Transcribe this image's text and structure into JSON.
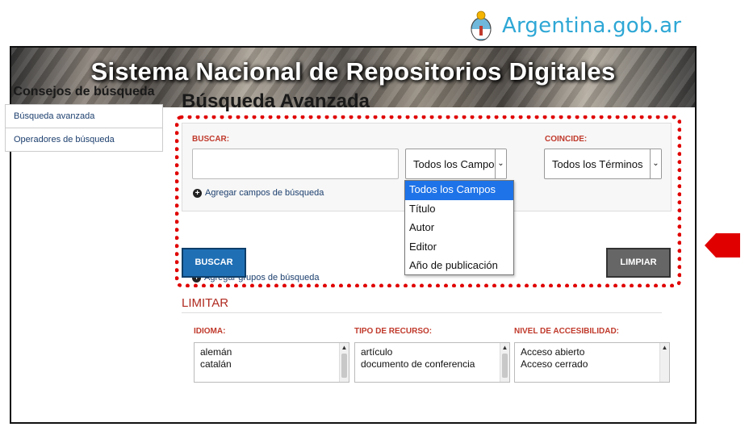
{
  "gov_header": {
    "site": "Argentina.gob.ar",
    "icon": "argentina-seal-icon"
  },
  "banner": {
    "title": "Sistema Nacional de Repositorios Digitales"
  },
  "sidebar": {
    "title": "Consejos de búsqueda",
    "items": [
      {
        "label": "Búsqueda avanzada"
      },
      {
        "label": "Operadores de búsqueda"
      }
    ]
  },
  "main": {
    "title": "Búsqueda Avanzada",
    "search": {
      "buscar_label": "BUSCAR:",
      "query_value": "",
      "field_select_value": "Todos los Campos",
      "coincide_label": "COINCIDE:",
      "match_select_value": "Todos los Términos",
      "add_fields_label": "Agregar campos de búsqueda",
      "add_groups_label": "Agregar grupos de búsqueda"
    },
    "dropdown_options": [
      {
        "label": "Todos los Campos",
        "selected": true
      },
      {
        "label": "Título",
        "selected": false
      },
      {
        "label": "Autor",
        "selected": false
      },
      {
        "label": "Editor",
        "selected": false
      },
      {
        "label": "Año de publicación",
        "selected": false
      }
    ],
    "buttons": {
      "search": "BUSCAR",
      "clear": "LIMPIAR"
    },
    "limit": {
      "title": "LIMITAR",
      "columns": [
        {
          "label": "IDIOMA:",
          "items": [
            "alemán",
            "catalán"
          ]
        },
        {
          "label": "TIPO DE RECURSO:",
          "items": [
            "artículo",
            "documento de conferencia"
          ]
        },
        {
          "label": "NIVEL DE ACCESIBILIDAD:",
          "items": [
            "Acceso abierto",
            "Acceso cerrado"
          ]
        }
      ]
    }
  },
  "colors": {
    "accent_red": "#e00000",
    "primary_blue": "#1f6fb5",
    "gov_blue": "#2ea7d5",
    "selected_option": "#1e73e8"
  }
}
